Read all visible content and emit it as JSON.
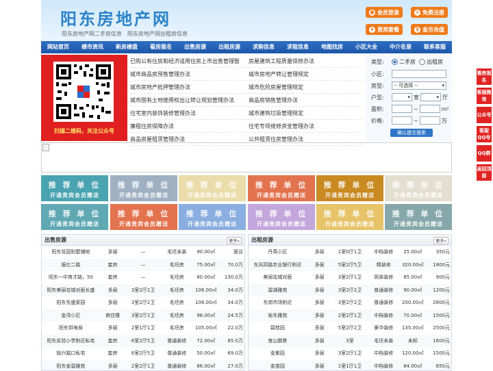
{
  "header": {
    "logo": "阳东房地产网",
    "sub1": "阳东房地产网二手房信息",
    "sub2": "阳东房地产网出租房信息",
    "buttons": [
      {
        "label": "会员登录",
        "icon": "user-icon"
      },
      {
        "label": "免费注册",
        "icon": "register-icon"
      },
      {
        "label": "贵宾套餐",
        "icon": "vip-icon"
      },
      {
        "label": "金币充值",
        "icon": "coin-icon"
      }
    ],
    "accent": "#ef7a1a"
  },
  "nav": [
    "网站首页",
    "楼市资讯",
    "新房楼盘",
    "看房报名",
    "出售房源",
    "出租房源",
    "求购信息",
    "求租信息",
    "地图找房",
    "小区大全",
    "中介名录",
    "联系客服"
  ],
  "qr": {
    "caption": "扫描二维码，关注公众号"
  },
  "links": [
    [
      "已购公有住房和经济适用住房上市出售管理暂",
      "房屋建筑工程质量保修办法"
    ],
    [
      "城市商品房预售管理办法",
      "城市房地产转让管理规定"
    ],
    [
      "城市房地产抵押管理办法",
      "城市危险房屋管理规定"
    ],
    [
      "城市国有土地使用权出让转让规划管理办法",
      "商品房销售管理办法"
    ],
    [
      "住宅室内装饰装修管理办法",
      "城市建筑垃圾管理规定"
    ],
    [
      "廉租住房保障办法",
      "住宅专项维修资金管理办法"
    ],
    [
      "商品房屋租赁管理办法",
      "公共租赁住房管理办法"
    ]
  ],
  "search": {
    "type_label": "类型:",
    "opt1": "二手房",
    "opt2": "出租房",
    "community_label": "小区:",
    "housetype_label": "房型:",
    "housetype_value": "-- 可选择 --",
    "layout_label": "户型:",
    "room_unit": "室",
    "hall_unit": "厅",
    "area_label": "面积:",
    "area_unit": "m²",
    "price_label": "价格:",
    "price_unit": "万",
    "tilde": "~",
    "submit": "确认提交搜索"
  },
  "ads": {
    "line1": "推 荐 单 位",
    "line2": "开通贵宾会员赠送",
    "colors": [
      "#4aa3b0",
      "#8ea3b8",
      "#e8d9a8",
      "#e3734e",
      "#c98a22",
      "#e6e2d4",
      "#5fa8b4",
      "#e3734e",
      "#7a9fd6",
      "#bfa0d6",
      "#e3c163",
      "#7ea3a6"
    ]
  },
  "sale": {
    "title": "出售房源",
    "more": "更多»",
    "rows": [
      [
        "阳东花园别墅铺地",
        "多层",
        "—",
        "毛坯未装",
        "90.00㎡",
        "面议"
      ],
      [
        "振仕二路",
        "套房",
        "—",
        "毛坯房",
        "75.00㎡",
        "70.0万"
      ],
      [
        "阳东一中育才路，50",
        "套房",
        "—",
        "毛坯房",
        "80.00㎡",
        "130.0万"
      ],
      [
        "阳东美丽花城对面长盛",
        "多层",
        "3室2厅2卫",
        "毛坯房",
        "106.00㎡",
        "34.0万"
      ],
      [
        "阳东东盛家园",
        "多层",
        "3室2厅2卫",
        "毛坯房",
        "106.00㎡",
        "34.0万"
      ],
      [
        "金湾小区",
        "商住楼",
        "3室2厅2卫",
        "毛坯房",
        "98.00㎡",
        "24.5万"
      ],
      [
        "阳东供电局",
        "多层",
        "2室1厅1卫",
        "毛坯房",
        "105.00㎡",
        "22.0万"
      ],
      [
        "阳东实验小学附近私宅",
        "套房",
        "6室2厅5卫",
        "普通装修",
        "72.00㎡",
        "85.0万"
      ],
      [
        "始兴路口私宅",
        "套房",
        "6室2厅5卫",
        "普通装修",
        "50.00㎡",
        "69.0万"
      ],
      [
        "阳东金碧雅苑",
        "多层",
        "2室2厅1卫",
        "普通装修",
        "86.00㎡",
        "27.0万"
      ]
    ]
  },
  "rent": {
    "title": "出租房源",
    "more": "更多»",
    "rows": [
      [
        "丹燕小区",
        "多层",
        "1室0厅1卫",
        "中档装修",
        "25.00㎡",
        "350元"
      ],
      [
        "东风四路农业银行附近",
        "多层",
        "5室2厅5卫",
        "精装修",
        "320.00㎡",
        "1800元"
      ],
      [
        "美丽花城对面",
        "多层",
        "3室2厅1卫",
        "简单装修",
        "85.00㎡",
        "900元"
      ],
      [
        "碧湖雅苑",
        "多层",
        "3室2厅2卫",
        "普通装修",
        "90.00㎡",
        "1200元"
      ],
      [
        "东岗市场附近",
        "多层",
        "3室2厅2卫",
        "普通装修",
        "200.00㎡",
        "2800元"
      ],
      [
        "裕东雅苑",
        "多层",
        "2室2厅1卫",
        "中档装修",
        "70.00㎡",
        "1500元"
      ],
      [
        "碧桂园",
        "多层",
        "5室2厅2卫",
        "豪华装修",
        "135.00㎡",
        "2500元"
      ],
      [
        "官山御景",
        "多层",
        "3室",
        "毛坯未装",
        "未知",
        "1600元"
      ],
      [
        "金紫园",
        "多层",
        "3室2厅1卫",
        "中档装修",
        "120.00㎡",
        "1500元"
      ],
      [
        "金苗园",
        "多层",
        "1室1厅1卫",
        "中档装修",
        "84.00㎡",
        "850元"
      ]
    ]
  },
  "side": [
    "看房报名",
    "客服微信",
    "公众号",
    "客服QQ号",
    "QQ群",
    "返回顶部"
  ],
  "colors": {
    "nav": "#1d56a8",
    "side": "#e02323",
    "red": "#e02020"
  }
}
